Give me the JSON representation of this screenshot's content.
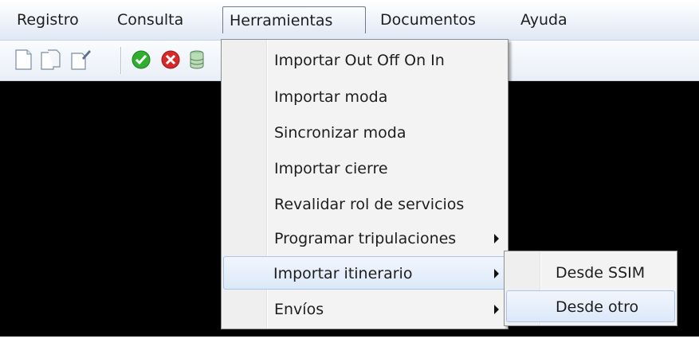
{
  "menubar": {
    "items": [
      {
        "label": "Registro"
      },
      {
        "label": "Consulta"
      },
      {
        "label": "Herramientas"
      },
      {
        "label": "Documentos"
      },
      {
        "label": "Ayuda"
      }
    ]
  },
  "toolbar": {
    "buttons": [
      {
        "icon": "new-document-icon"
      },
      {
        "icon": "copy-document-icon"
      },
      {
        "icon": "edit-document-icon"
      },
      {
        "icon": "accept-icon"
      },
      {
        "icon": "cancel-icon"
      },
      {
        "icon": "database-icon"
      }
    ]
  },
  "dropdown": {
    "items": [
      {
        "label": "Importar Out Off On In"
      },
      {
        "label": "Importar moda"
      },
      {
        "label": "Sincronizar moda"
      },
      {
        "label": "Importar cierre"
      },
      {
        "label": "Revalidar rol de servicios"
      },
      {
        "label": "Programar tripulaciones"
      },
      {
        "label": "Importar itinerario"
      },
      {
        "label": "Envíos"
      }
    ]
  },
  "submenu": {
    "items": [
      {
        "label": "Desde SSIM"
      },
      {
        "label": "Desde otro"
      }
    ]
  },
  "colors": {
    "highlight_border": "#a9c5ec",
    "content_background": "#000000",
    "accept_green": "#2fae2f",
    "cancel_red": "#d42a2a"
  }
}
